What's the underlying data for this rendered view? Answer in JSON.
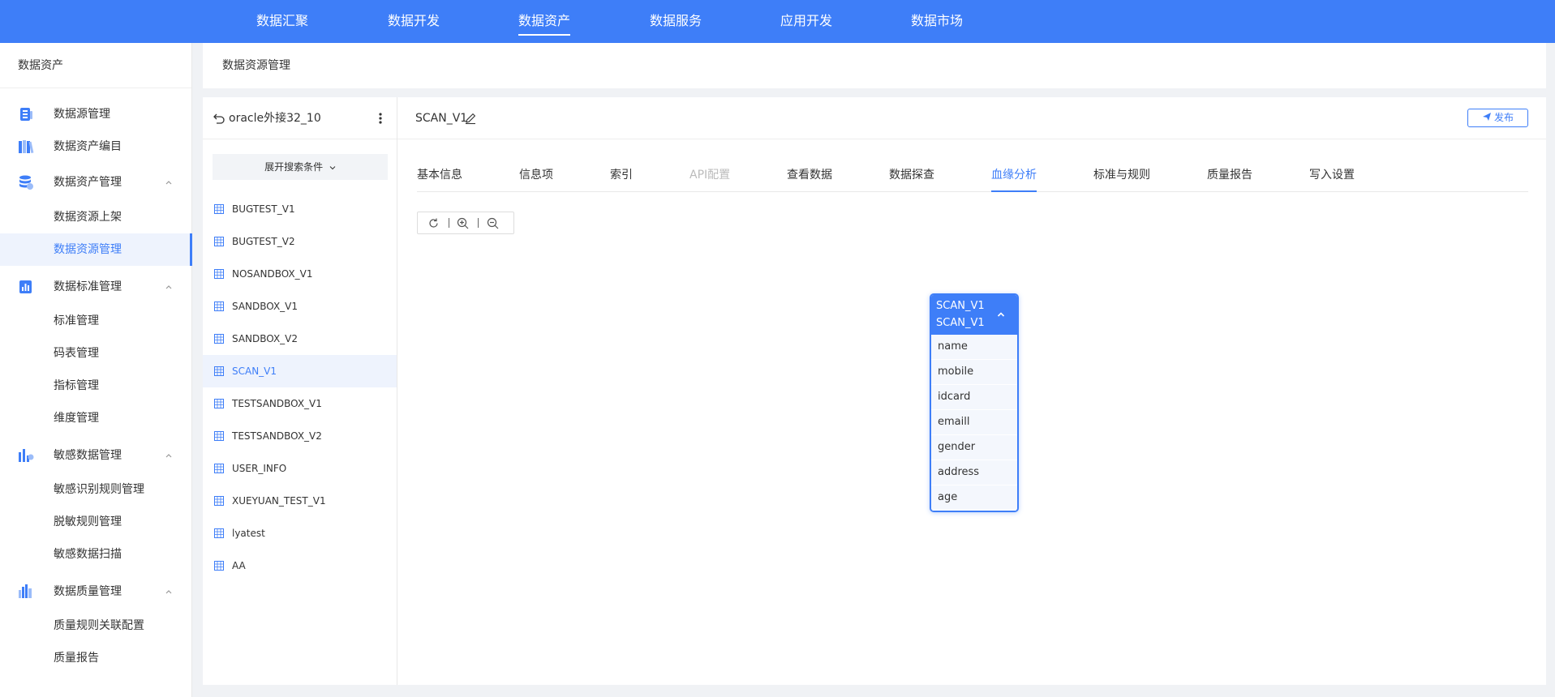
{
  "topnav": {
    "items": [
      "数据汇聚",
      "数据开发",
      "数据资产",
      "数据服务",
      "应用开发",
      "数据市场"
    ],
    "active": "数据资产"
  },
  "sidebar": {
    "title": "数据资产",
    "groups": {
      "source": {
        "label": "数据源管理",
        "icon": "database-icon"
      },
      "catalog": {
        "label": "数据资产编目",
        "icon": "books-icon"
      },
      "asset": {
        "label": "数据资产管理",
        "icon": "stack-icon",
        "items": [
          "数据资源上架",
          "数据资源管理"
        ]
      },
      "standard": {
        "label": "数据标准管理",
        "icon": "bar-chart-icon",
        "items": [
          "标准管理",
          "码表管理",
          "指标管理",
          "维度管理"
        ]
      },
      "sensitive": {
        "label": "敏感数据管理",
        "icon": "shield-chart-icon",
        "items": [
          "敏感识别规则管理",
          "脱敏规则管理",
          "敏感数据扫描"
        ]
      },
      "quality": {
        "label": "数据质量管理",
        "icon": "quality-chart-icon",
        "items": [
          "质量规则关联配置",
          "质量报告"
        ]
      }
    },
    "active_item": "数据资源管理"
  },
  "header": {
    "breadcrumb": "数据资源管理"
  },
  "list_panel": {
    "source_name": "oracle外接32_10",
    "expand_label": "展开搜索条件",
    "tables": [
      "BUGTEST_V1",
      "BUGTEST_V2",
      "NOSANDBOX_V1",
      "SANDBOX_V1",
      "SANDBOX_V2",
      "SCAN_V1",
      "TESTSANDBOX_V1",
      "TESTSANDBOX_V2",
      "USER_INFO",
      "XUEYUAN_TEST_V1",
      "lyatest",
      "AA"
    ],
    "selected": "SCAN_V1"
  },
  "detail": {
    "table_name": "SCAN_V1",
    "publish_label": "发布",
    "tabs": [
      "基本信息",
      "信息项",
      "索引",
      "API配置",
      "查看数据",
      "数据探查",
      "血缘分析",
      "标准与规则",
      "质量报告",
      "写入设置"
    ],
    "active_tab": "血缘分析",
    "disabled_tab": "API配置"
  },
  "lineage_node": {
    "title_line1": "SCAN_V1",
    "title_line2": "SCAN_V1",
    "fields": [
      "name",
      "mobile",
      "idcard",
      "emaill",
      "gender",
      "address",
      "age"
    ]
  },
  "colors": {
    "primary": "#3e7ef8",
    "active_bg": "#eef3fd",
    "page_bg": "#f0f2f5"
  }
}
